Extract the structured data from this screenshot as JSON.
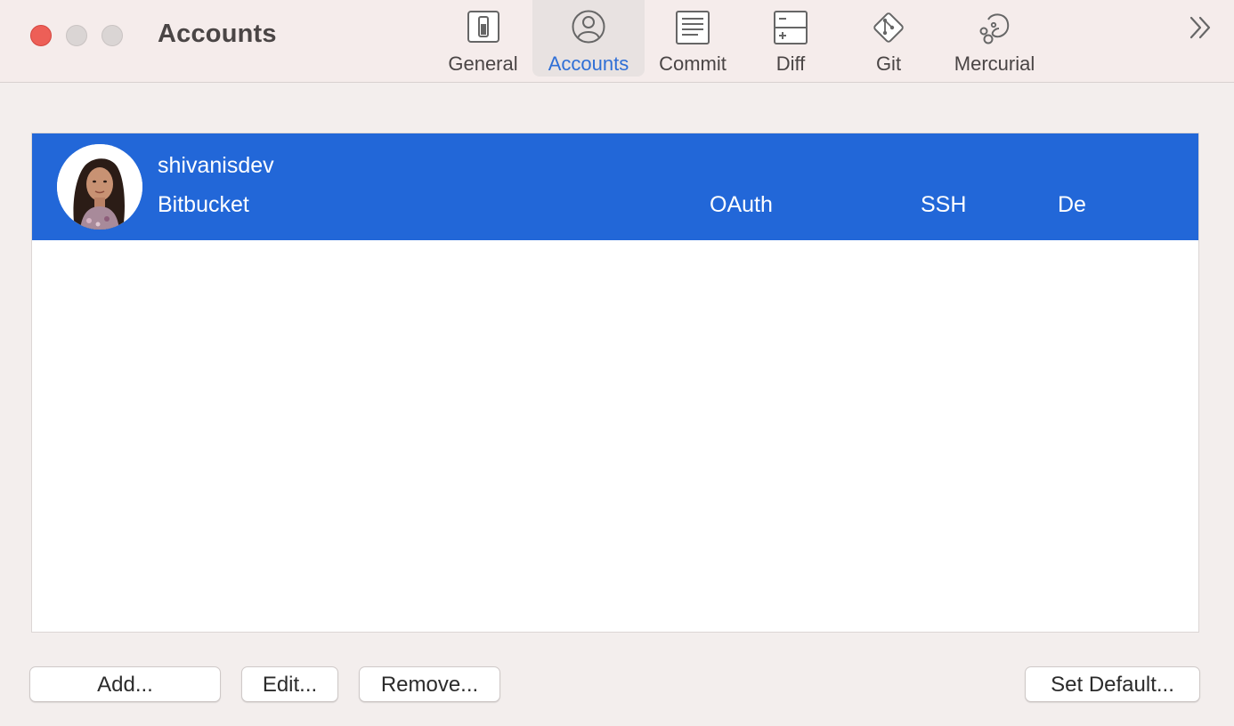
{
  "window": {
    "title": "Accounts"
  },
  "toolbar": {
    "tabs": [
      {
        "label": "General",
        "icon": "general-icon",
        "active": false
      },
      {
        "label": "Accounts",
        "icon": "accounts-icon",
        "active": true
      },
      {
        "label": "Commit",
        "icon": "commit-icon",
        "active": false
      },
      {
        "label": "Diff",
        "icon": "diff-icon",
        "active": false
      },
      {
        "label": "Git",
        "icon": "git-icon",
        "active": false
      },
      {
        "label": "Mercurial",
        "icon": "mercurial-icon",
        "active": false
      }
    ],
    "overflow_icon": "chevrons-right-icon"
  },
  "accounts": [
    {
      "username": "shivanisdev",
      "service": "Bitbucket",
      "auth": "OAuth",
      "protocol": "SSH",
      "default_flag": "Default",
      "selected": true
    }
  ],
  "buttons": {
    "add": "Add...",
    "edit": "Edit...",
    "remove": "Remove...",
    "set_default": "Set Default..."
  },
  "colors": {
    "accent": "#2267d8",
    "active_tab_text": "#2f6fd6",
    "close_button": "#ed5f57"
  }
}
